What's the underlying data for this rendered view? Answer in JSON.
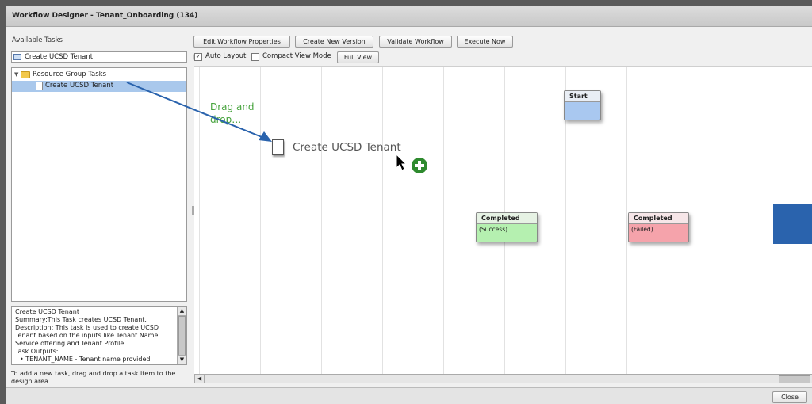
{
  "window": {
    "title": "Workflow Designer - Tenant_Onboarding (134)"
  },
  "left_panel": {
    "available_label": "Available Tasks",
    "search_value": "Create UCSD Tenant",
    "tree": {
      "folder_label": "Resource Group Tasks",
      "item_label": "Create UCSD Tenant"
    },
    "description": [
      "Create UCSD Tenant",
      "Summary:This Task creates UCSD Tenant.",
      "Description: This task is used to create UCSD",
      "Tenant based on the inputs like Tenant Name,",
      "Service offering and Tenant Profile.",
      "Task Outputs:",
      "•   TENANT_NAME - Tenant name provided"
    ],
    "hint": "To add a new task, drag and drop a task item to the design area."
  },
  "toolbar": {
    "edit_properties": "Edit Workflow Properties",
    "create_version": "Create New Version",
    "validate": "Validate Workflow",
    "execute": "Execute Now",
    "auto_layout": "Auto Layout",
    "auto_layout_checked": true,
    "compact_view": "Compact View Mode",
    "compact_view_checked": false,
    "full_view": "Full View"
  },
  "canvas": {
    "annotation": "Drag and drop…",
    "drag_item_label": "Create UCSD Tenant",
    "start_node": {
      "title": "Start"
    },
    "success_node": {
      "title": "Completed",
      "subtitle": "(Success)"
    },
    "failed_node": {
      "title": "Completed",
      "subtitle": "(Failed)"
    }
  },
  "footer": {
    "close_label": "Close"
  },
  "colors": {
    "start_fill": "#a9c8f0",
    "success_fill": "#b5f0b0",
    "failed_fill": "#f5a3ab",
    "accent_blue": "#2a63ad",
    "annotation_green": "#44a23a",
    "add_icon_green": "#2e8a2e"
  }
}
